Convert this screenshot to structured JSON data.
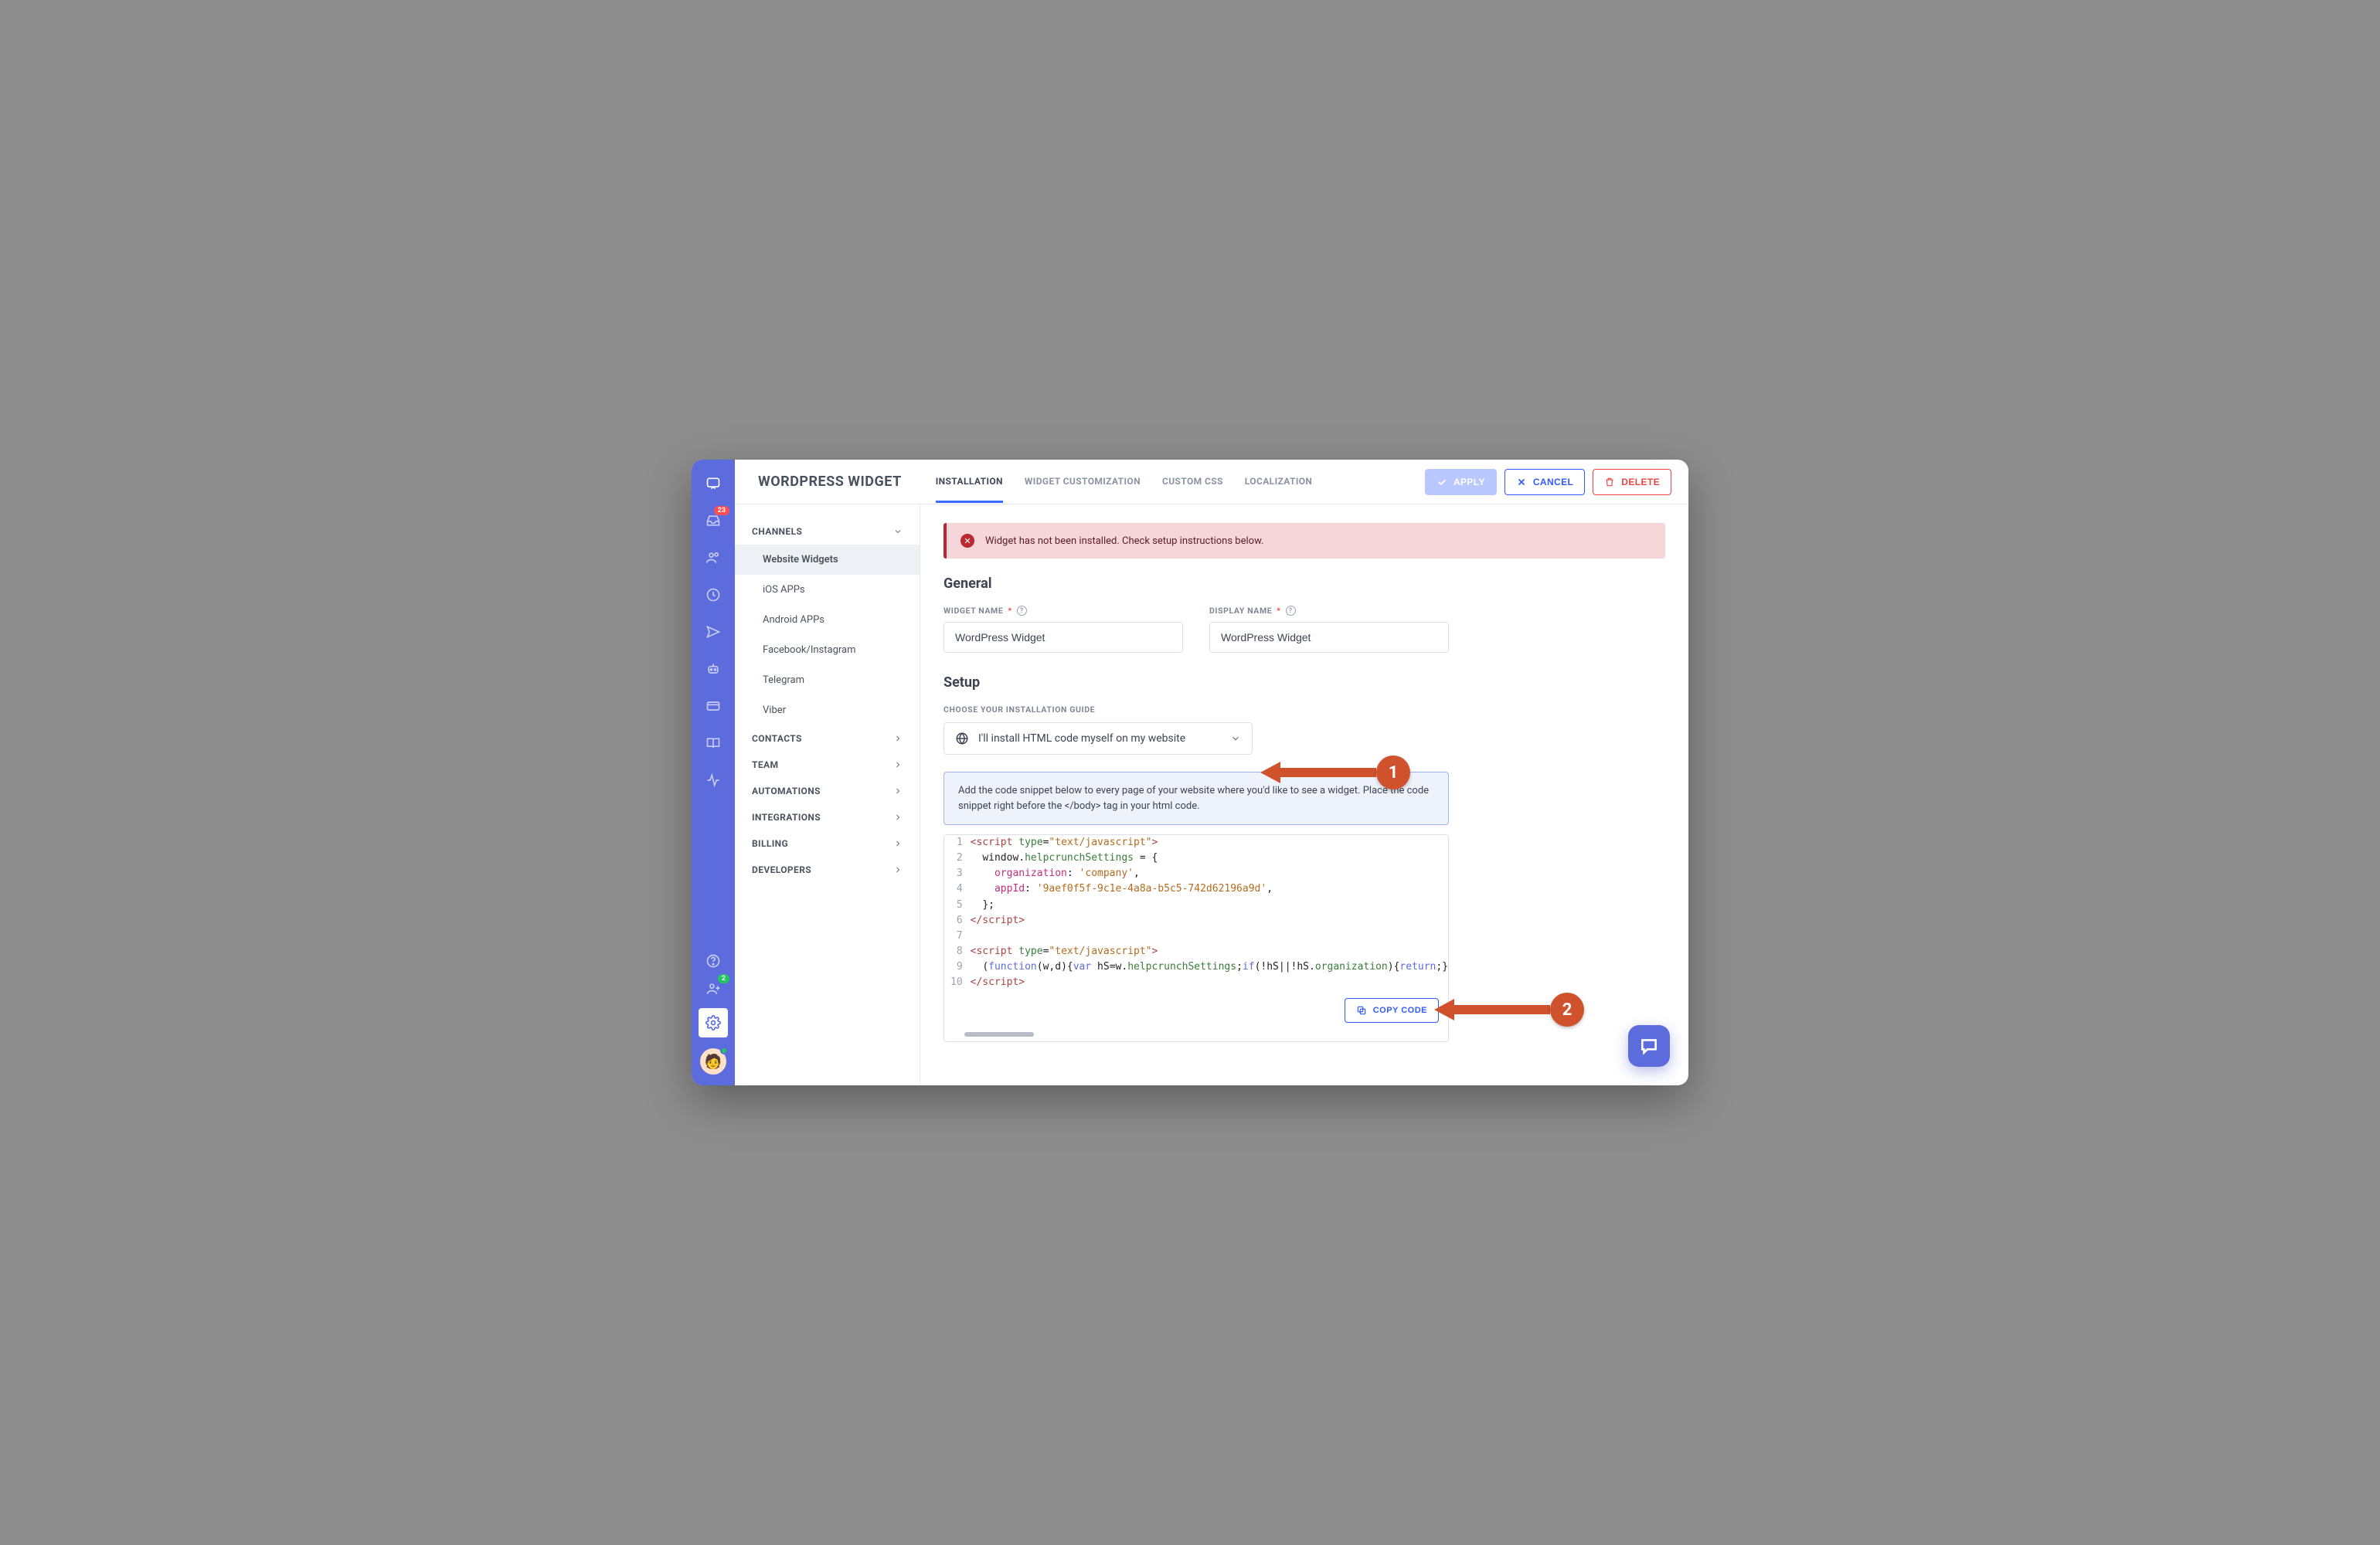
{
  "header": {
    "page_title": "WORDPRESS WIDGET",
    "tabs": [
      "INSTALLATION",
      "WIDGET CUSTOMIZATION",
      "CUSTOM CSS",
      "LOCALIZATION"
    ],
    "active_tab_index": 0,
    "apply_label": "APPLY",
    "cancel_label": "CANCEL",
    "delete_label": "DELETE"
  },
  "rail": {
    "inbox_badge": "23",
    "user_badge": "2"
  },
  "sidenav": {
    "sections": [
      {
        "label": "CHANNELS",
        "expanded": true,
        "items": [
          "Website Widgets",
          "iOS APPs",
          "Android APPs",
          "Facebook/Instagram",
          "Telegram",
          "Viber"
        ],
        "active_index": 0
      },
      {
        "label": "CONTACTS"
      },
      {
        "label": "TEAM"
      },
      {
        "label": "AUTOMATIONS"
      },
      {
        "label": "INTEGRATIONS"
      },
      {
        "label": "BILLING"
      },
      {
        "label": "DEVELOPERS"
      }
    ]
  },
  "alert_text": "Widget has not been installed. Check setup instructions below.",
  "general": {
    "title": "General",
    "widget_name_label": "WIDGET NAME",
    "widget_name_value": "WordPress Widget",
    "display_name_label": "DISPLAY NAME",
    "display_name_value": "WordPress Widget"
  },
  "setup": {
    "title": "Setup",
    "guide_label": "CHOOSE YOUR INSTALLATION GUIDE",
    "guide_selected": "I'll install HTML code myself on my website",
    "info_text": "Add the code snippet below to every page of your website where you'd like to see a widget. Place the code snippet right before the </body> tag in your html code.",
    "copy_label": "COPY CODE",
    "code": {
      "organization": "company",
      "app_id": "9aef0f5f-9c1e-4a8a-b5c5-742d62196a9d"
    }
  },
  "annotations": {
    "one": "1",
    "two": "2"
  }
}
